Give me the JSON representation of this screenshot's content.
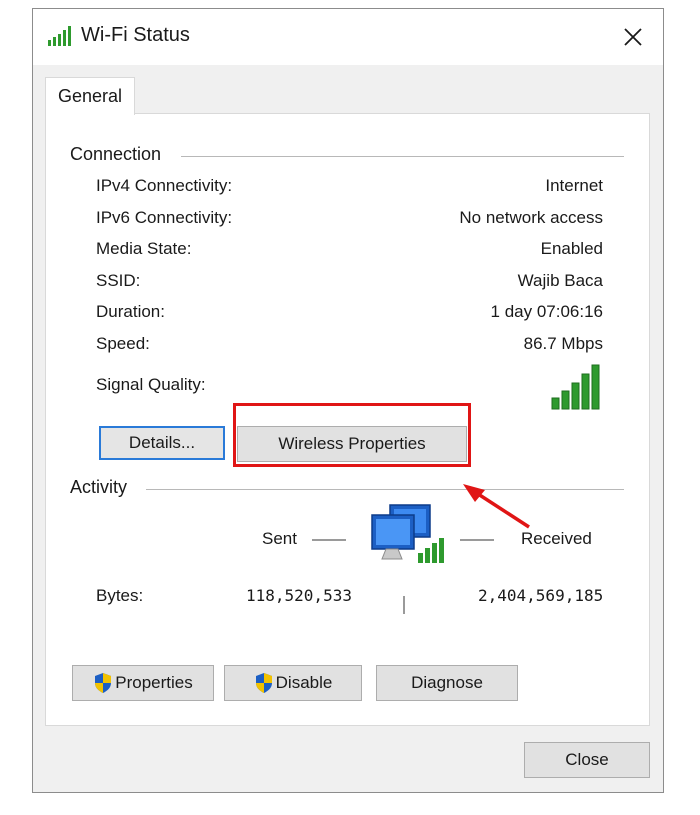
{
  "window": {
    "title": "Wi-Fi Status",
    "icons": {
      "title": "wifi-signal-icon",
      "close": "close-icon"
    }
  },
  "tabs": [
    {
      "label": "General",
      "selected": true
    }
  ],
  "connection": {
    "heading": "Connection",
    "rows": [
      {
        "label": "IPv4 Connectivity:",
        "value": "Internet"
      },
      {
        "label": "IPv6 Connectivity:",
        "value": "No network access"
      },
      {
        "label": "Media State:",
        "value": "Enabled"
      },
      {
        "label": "SSID:",
        "value": "Wajib Baca"
      },
      {
        "label": "Duration:",
        "value": "1 day 07:06:16"
      },
      {
        "label": "Speed:",
        "value": "86.7 Mbps"
      }
    ],
    "signal_label": "Signal Quality:",
    "signal_bars_lit": 5,
    "signal_bars_total": 5,
    "details_button": "Details...",
    "wireless_properties_button": "Wireless Properties"
  },
  "activity": {
    "heading": "Activity",
    "sent_label": "Sent",
    "received_label": "Received",
    "bytes_label": "Bytes:",
    "bytes_sent": "118,520,533",
    "bytes_received": "2,404,569,185"
  },
  "buttons": {
    "properties": "Properties",
    "disable": "Disable",
    "diagnose": "Diagnose",
    "close": "Close"
  },
  "colors": {
    "signal_green": "#2e9a2e",
    "highlight_red": "#e01515",
    "focus_blue": "#2a7ad8"
  }
}
